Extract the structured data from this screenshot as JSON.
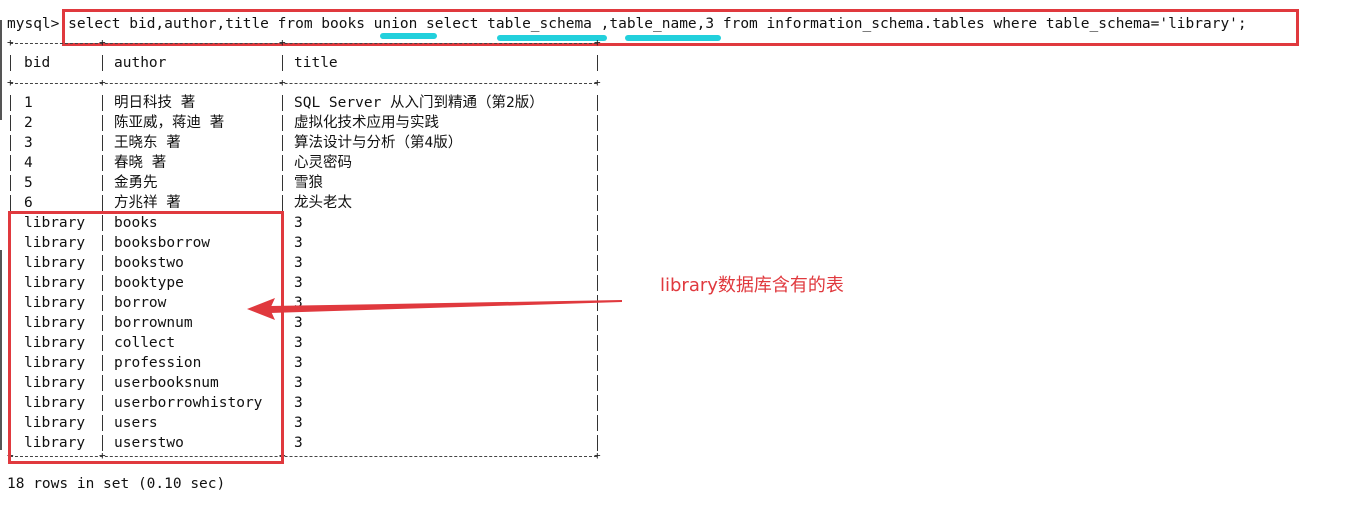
{
  "terminal": {
    "prompt": "mysql>",
    "command": "select bid,author,title from books union select table_schema ,table_name,3 from information_schema.tables where table_schema='library';",
    "columns": [
      "bid",
      "author",
      "title"
    ],
    "rows": [
      [
        "1",
        "明日科技 著",
        "SQL Server 从入门到精通（第2版）"
      ],
      [
        "2",
        "陈亚威，蒋迪 著",
        "虚拟化技术应用与实践"
      ],
      [
        "3",
        "王晓东 著",
        "算法设计与分析（第4版）"
      ],
      [
        "4",
        "春晓 著",
        "心灵密码"
      ],
      [
        "5",
        "金勇先",
        "雪狼"
      ],
      [
        "6",
        "方兆祥 著",
        "龙头老太"
      ],
      [
        "library",
        "books",
        "3"
      ],
      [
        "library",
        "booksborrow",
        "3"
      ],
      [
        "library",
        "bookstwo",
        "3"
      ],
      [
        "library",
        "booktype",
        "3"
      ],
      [
        "library",
        "borrow",
        "3"
      ],
      [
        "library",
        "borrownum",
        "3"
      ],
      [
        "library",
        "collect",
        "3"
      ],
      [
        "library",
        "profession",
        "3"
      ],
      [
        "library",
        "userbooksnum",
        "3"
      ],
      [
        "library",
        "userborrowhistory",
        "3"
      ],
      [
        "library",
        "users",
        "3"
      ],
      [
        "library",
        "userstwo",
        "3"
      ]
    ],
    "status": "18 rows in set (0.10 sec)"
  },
  "annotations": {
    "note_text": "library数据库含有的表",
    "highlight_words": [
      "union",
      "table_schema",
      "table_name"
    ],
    "accent_red": "#e0393e",
    "accent_cyan": "#22d0dc"
  }
}
